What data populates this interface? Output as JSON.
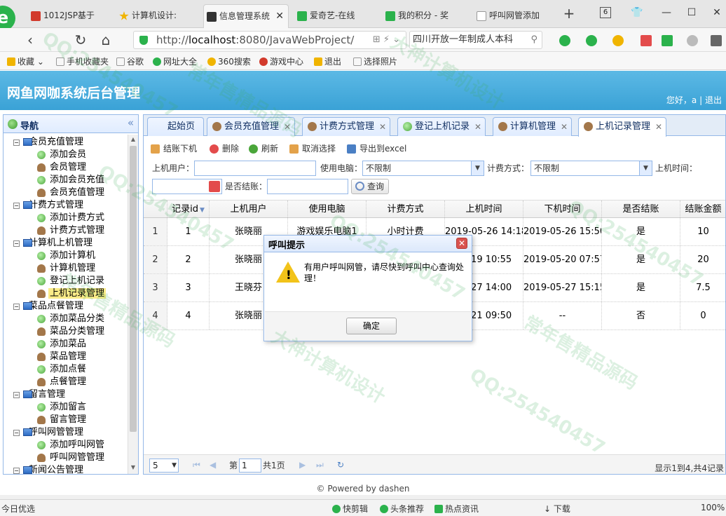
{
  "browser": {
    "tabs": [
      {
        "label": "1012JSP基于",
        "fav_color": "#d23a2c"
      },
      {
        "label": "计算机设计:",
        "fav_color": "#f0b400"
      },
      {
        "label": "信息管理系统",
        "fav_color": "#333333"
      },
      {
        "label": "爱奇艺-在线",
        "fav_color": "#2bb24c"
      },
      {
        "label": "我的积分 - 奖",
        "fav_color": "#2bb24c"
      },
      {
        "label": "呼叫网管添加",
        "fav_color": "#999999"
      }
    ],
    "tab_close": "✕",
    "new_tab": "+",
    "tab_count": "6",
    "url_prefix": "http://",
    "url_host": "localhost",
    "url_rest": ":8080/JavaWebProject/",
    "search_text": "四川开放一年制成人本科",
    "icons": {
      "back": "chevron-left-icon",
      "refresh": "refresh-icon",
      "home": "home-icon"
    }
  },
  "bookmarks": [
    {
      "label": "收藏",
      "color": "#f0b400"
    },
    {
      "label": "手机收藏夹",
      "color": "#999999"
    },
    {
      "label": "谷歌",
      "color": "#999999"
    },
    {
      "label": "网址大全",
      "color": "#2bb24c"
    },
    {
      "label": "360搜索",
      "color": "#f0b400"
    },
    {
      "label": "游戏中心",
      "color": "#d23a2c"
    },
    {
      "label": "退出",
      "color": "#f0b400"
    },
    {
      "label": "选择照片",
      "color": "#999999"
    }
  ],
  "header": {
    "title": "网鱼网咖系统后台管理",
    "welcome": "您好，a",
    "sep": "|",
    "logout": "退出"
  },
  "nav": {
    "title": "导航",
    "collapse": "«",
    "groups": [
      {
        "label": "会员充值管理",
        "children": [
          {
            "label": "添加会员",
            "icon": "add"
          },
          {
            "label": "会员管理",
            "icon": "user"
          },
          {
            "label": "添加会员充值",
            "icon": "add"
          },
          {
            "label": "会员充值管理",
            "icon": "user"
          }
        ]
      },
      {
        "label": "计费方式管理",
        "children": [
          {
            "label": "添加计费方式",
            "icon": "add"
          },
          {
            "label": "计费方式管理",
            "icon": "user"
          }
        ]
      },
      {
        "label": "计算机上机管理",
        "children": [
          {
            "label": "添加计算机",
            "icon": "add"
          },
          {
            "label": "计算机管理",
            "icon": "user"
          },
          {
            "label": "登记上机记录",
            "icon": "add"
          },
          {
            "label": "上机记录管理",
            "icon": "user",
            "selected": true
          }
        ]
      },
      {
        "label": "菜品点餐管理",
        "children": [
          {
            "label": "添加菜品分类",
            "icon": "add"
          },
          {
            "label": "菜品分类管理",
            "icon": "user"
          },
          {
            "label": "添加菜品",
            "icon": "add"
          },
          {
            "label": "菜品管理",
            "icon": "user"
          },
          {
            "label": "添加点餐",
            "icon": "add"
          },
          {
            "label": "点餐管理",
            "icon": "user"
          }
        ]
      },
      {
        "label": "留言管理",
        "children": [
          {
            "label": "添加留言",
            "icon": "add"
          },
          {
            "label": "留言管理",
            "icon": "user"
          }
        ]
      },
      {
        "label": "呼叫网管管理",
        "children": [
          {
            "label": "添加呼叫网管",
            "icon": "add"
          },
          {
            "label": "呼叫网管管理",
            "icon": "user"
          }
        ]
      },
      {
        "label": "新闻公告管理",
        "children": []
      }
    ]
  },
  "content_tabs": [
    {
      "label": "起始页",
      "closable": false,
      "icon_color": ""
    },
    {
      "label": "会员充值管理",
      "closable": true,
      "icon_color": "#a3774a"
    },
    {
      "label": "计费方式管理",
      "closable": true,
      "icon_color": "#a3774a"
    },
    {
      "label": "登记上机记录",
      "closable": true,
      "icon_color": "#4aa63a"
    },
    {
      "label": "计算机管理",
      "closable": true,
      "icon_color": "#a3774a"
    },
    {
      "label": "上机记录管理",
      "closable": true,
      "icon_color": "#a3774a",
      "active": true
    }
  ],
  "toolbar": {
    "checkout": "结账下机",
    "delete": "删除",
    "refresh": "刷新",
    "cancel_select": "取消选择",
    "export": "导出到excel"
  },
  "filters": {
    "user_label": "上机用户：",
    "user_value": "",
    "computer_label": "使用电脑：",
    "computer_value": "不限制",
    "fee_label": "计费方式：",
    "fee_value": "不限制",
    "time_label": "上机时间：",
    "time_value": "",
    "settled_label": "是否结账：",
    "settled_value": "",
    "query_button": "查询"
  },
  "grid": {
    "columns": [
      "记录id",
      "上机用户",
      "使用电脑",
      "计费方式",
      "上机时间",
      "下机时间",
      "是否结账",
      "结账金额"
    ],
    "sort_indicator": "▼",
    "rows": [
      {
        "num": "1",
        "id": "1",
        "user": "张晓丽",
        "computer": "游戏娱乐电脑1",
        "fee": "小时计费",
        "start": "2019-05-26 14:18",
        "end": "2019-05-26 15:50",
        "settled": "是",
        "amount": "10"
      },
      {
        "num": "2",
        "id": "2",
        "user": "张晓丽",
        "computer": "",
        "fee": "",
        "start": "05-19 10:55",
        "end": "2019-05-20 07:57",
        "settled": "是",
        "amount": "20"
      },
      {
        "num": "3",
        "id": "3",
        "user": "王晓芬",
        "computer": "",
        "fee": "",
        "start": "05-27 14:00",
        "end": "2019-05-27 15:15",
        "settled": "是",
        "amount": "7.5"
      },
      {
        "num": "4",
        "id": "4",
        "user": "张晓丽",
        "computer": "",
        "fee": "",
        "start": "06-21 09:50",
        "end": "--",
        "settled": "否",
        "amount": "0"
      }
    ]
  },
  "pager": {
    "page_size": "5",
    "page_prefix": "第",
    "page_number": "1",
    "page_total": "共1页",
    "info": "显示1到4,共4记录"
  },
  "modal": {
    "title": "呼叫提示",
    "close": "✕",
    "warn_mark": "!",
    "message": "有用户呼叫网管，请尽快到呼叫中心查询处理！",
    "ok": "确定"
  },
  "footer": {
    "powered": "© Powered by dashen"
  },
  "statusbar": {
    "left": "今日优选",
    "items": [
      {
        "label": "快剪辑",
        "color": "#2bb24c"
      },
      {
        "label": "头条推荐",
        "color": "#2bb24c"
      },
      {
        "label": "热点资讯",
        "color": "#2bb24c"
      },
      {
        "label": "下载",
        "color": "#999999"
      }
    ],
    "zoom": "100%"
  },
  "watermarks": [
    "QQ:254540457",
    "常年售精品源码",
    "大神计算机设计"
  ]
}
